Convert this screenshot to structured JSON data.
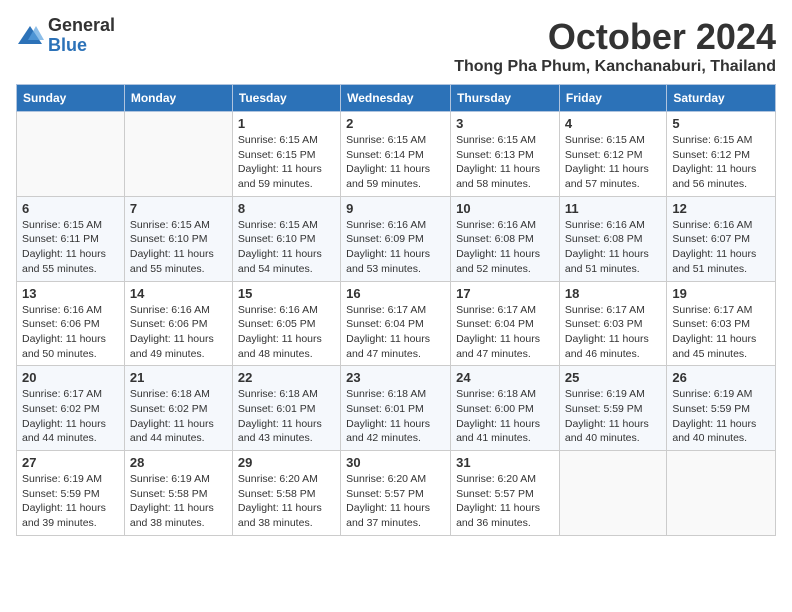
{
  "logo": {
    "general": "General",
    "blue": "Blue"
  },
  "title": "October 2024",
  "location": "Thong Pha Phum, Kanchanaburi, Thailand",
  "days_of_week": [
    "Sunday",
    "Monday",
    "Tuesday",
    "Wednesday",
    "Thursday",
    "Friday",
    "Saturday"
  ],
  "weeks": [
    [
      {
        "day": "",
        "info": ""
      },
      {
        "day": "",
        "info": ""
      },
      {
        "day": "1",
        "info": "Sunrise: 6:15 AM\nSunset: 6:15 PM\nDaylight: 11 hours and 59 minutes."
      },
      {
        "day": "2",
        "info": "Sunrise: 6:15 AM\nSunset: 6:14 PM\nDaylight: 11 hours and 59 minutes."
      },
      {
        "day": "3",
        "info": "Sunrise: 6:15 AM\nSunset: 6:13 PM\nDaylight: 11 hours and 58 minutes."
      },
      {
        "day": "4",
        "info": "Sunrise: 6:15 AM\nSunset: 6:12 PM\nDaylight: 11 hours and 57 minutes."
      },
      {
        "day": "5",
        "info": "Sunrise: 6:15 AM\nSunset: 6:12 PM\nDaylight: 11 hours and 56 minutes."
      }
    ],
    [
      {
        "day": "6",
        "info": "Sunrise: 6:15 AM\nSunset: 6:11 PM\nDaylight: 11 hours and 55 minutes."
      },
      {
        "day": "7",
        "info": "Sunrise: 6:15 AM\nSunset: 6:10 PM\nDaylight: 11 hours and 55 minutes."
      },
      {
        "day": "8",
        "info": "Sunrise: 6:15 AM\nSunset: 6:10 PM\nDaylight: 11 hours and 54 minutes."
      },
      {
        "day": "9",
        "info": "Sunrise: 6:16 AM\nSunset: 6:09 PM\nDaylight: 11 hours and 53 minutes."
      },
      {
        "day": "10",
        "info": "Sunrise: 6:16 AM\nSunset: 6:08 PM\nDaylight: 11 hours and 52 minutes."
      },
      {
        "day": "11",
        "info": "Sunrise: 6:16 AM\nSunset: 6:08 PM\nDaylight: 11 hours and 51 minutes."
      },
      {
        "day": "12",
        "info": "Sunrise: 6:16 AM\nSunset: 6:07 PM\nDaylight: 11 hours and 51 minutes."
      }
    ],
    [
      {
        "day": "13",
        "info": "Sunrise: 6:16 AM\nSunset: 6:06 PM\nDaylight: 11 hours and 50 minutes."
      },
      {
        "day": "14",
        "info": "Sunrise: 6:16 AM\nSunset: 6:06 PM\nDaylight: 11 hours and 49 minutes."
      },
      {
        "day": "15",
        "info": "Sunrise: 6:16 AM\nSunset: 6:05 PM\nDaylight: 11 hours and 48 minutes."
      },
      {
        "day": "16",
        "info": "Sunrise: 6:17 AM\nSunset: 6:04 PM\nDaylight: 11 hours and 47 minutes."
      },
      {
        "day": "17",
        "info": "Sunrise: 6:17 AM\nSunset: 6:04 PM\nDaylight: 11 hours and 47 minutes."
      },
      {
        "day": "18",
        "info": "Sunrise: 6:17 AM\nSunset: 6:03 PM\nDaylight: 11 hours and 46 minutes."
      },
      {
        "day": "19",
        "info": "Sunrise: 6:17 AM\nSunset: 6:03 PM\nDaylight: 11 hours and 45 minutes."
      }
    ],
    [
      {
        "day": "20",
        "info": "Sunrise: 6:17 AM\nSunset: 6:02 PM\nDaylight: 11 hours and 44 minutes."
      },
      {
        "day": "21",
        "info": "Sunrise: 6:18 AM\nSunset: 6:02 PM\nDaylight: 11 hours and 44 minutes."
      },
      {
        "day": "22",
        "info": "Sunrise: 6:18 AM\nSunset: 6:01 PM\nDaylight: 11 hours and 43 minutes."
      },
      {
        "day": "23",
        "info": "Sunrise: 6:18 AM\nSunset: 6:01 PM\nDaylight: 11 hours and 42 minutes."
      },
      {
        "day": "24",
        "info": "Sunrise: 6:18 AM\nSunset: 6:00 PM\nDaylight: 11 hours and 41 minutes."
      },
      {
        "day": "25",
        "info": "Sunrise: 6:19 AM\nSunset: 5:59 PM\nDaylight: 11 hours and 40 minutes."
      },
      {
        "day": "26",
        "info": "Sunrise: 6:19 AM\nSunset: 5:59 PM\nDaylight: 11 hours and 40 minutes."
      }
    ],
    [
      {
        "day": "27",
        "info": "Sunrise: 6:19 AM\nSunset: 5:59 PM\nDaylight: 11 hours and 39 minutes."
      },
      {
        "day": "28",
        "info": "Sunrise: 6:19 AM\nSunset: 5:58 PM\nDaylight: 11 hours and 38 minutes."
      },
      {
        "day": "29",
        "info": "Sunrise: 6:20 AM\nSunset: 5:58 PM\nDaylight: 11 hours and 38 minutes."
      },
      {
        "day": "30",
        "info": "Sunrise: 6:20 AM\nSunset: 5:57 PM\nDaylight: 11 hours and 37 minutes."
      },
      {
        "day": "31",
        "info": "Sunrise: 6:20 AM\nSunset: 5:57 PM\nDaylight: 11 hours and 36 minutes."
      },
      {
        "day": "",
        "info": ""
      },
      {
        "day": "",
        "info": ""
      }
    ]
  ]
}
